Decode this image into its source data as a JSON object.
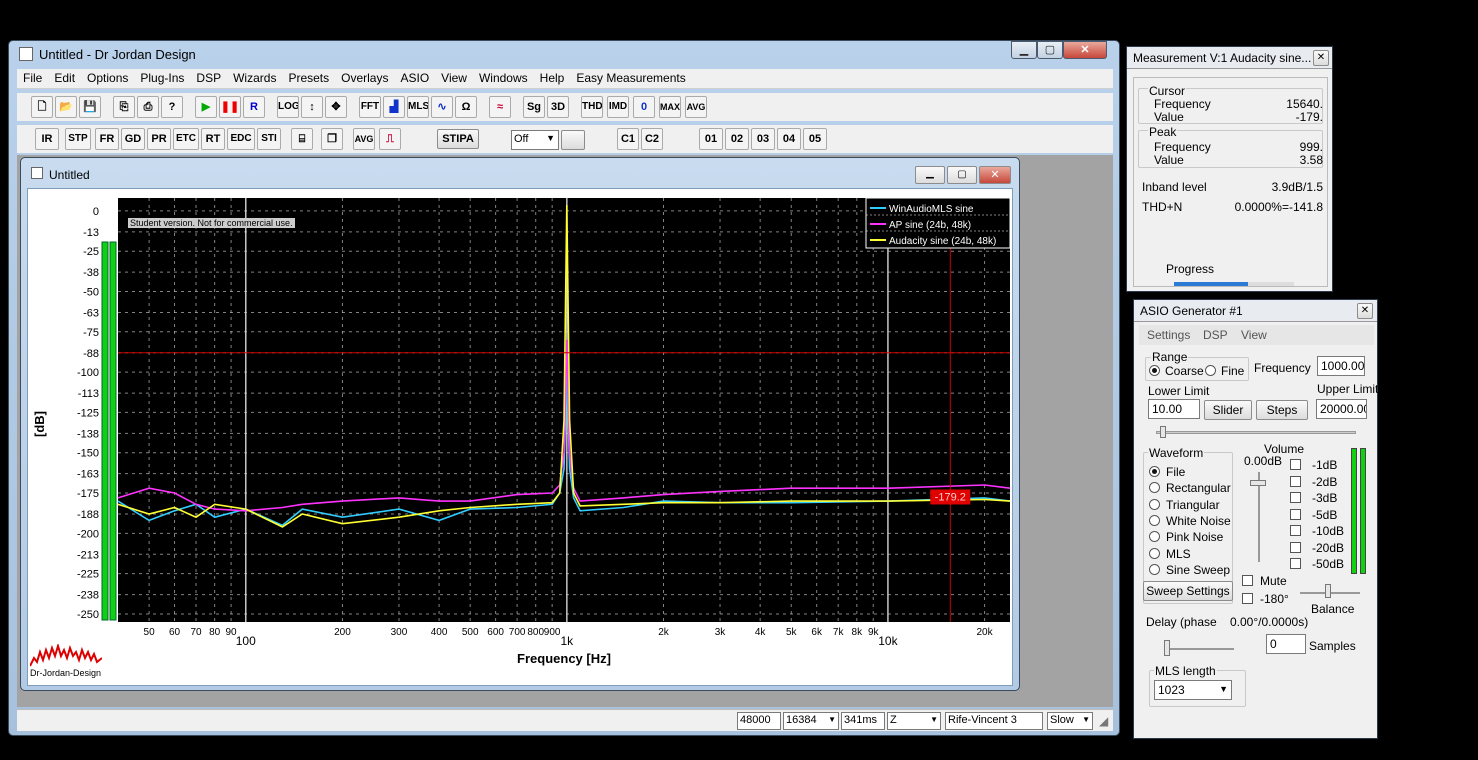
{
  "main": {
    "title": "Untitled - Dr Jordan Design",
    "menu": [
      "File",
      "Edit",
      "Options",
      "Plug-Ins",
      "DSP",
      "Wizards",
      "Presets",
      "Overlays",
      "ASIO",
      "View",
      "Windows",
      "Help",
      "Easy Measurements"
    ],
    "toolbar1": [
      "LOG",
      "FFT",
      "MLS",
      "Sg",
      "3D",
      "THD",
      "IMD",
      "0",
      "MAX",
      "AVG"
    ],
    "toolbar2": [
      "IR",
      "STP",
      "FR",
      "GD",
      "PR",
      "ETC",
      "RT",
      "EDC",
      "STI",
      "AVG",
      "STIPA",
      "C1",
      "C2",
      "01",
      "02",
      "03",
      "04",
      "05"
    ],
    "toolbar2_select": "Off",
    "status": {
      "rate": "48000",
      "fft": "16384",
      "time": "341ms",
      "mode": "Z",
      "window": "Rife-Vincent 3",
      "speed": "Slow"
    }
  },
  "child": {
    "title": "Untitled",
    "watermark": "Student version. Not for commercial use.",
    "logo_text": "Dr-Jordan-Design",
    "marker_label": "-179.2"
  },
  "chart_data": {
    "type": "line",
    "xlabel": "Frequency [Hz]",
    "ylabel": "[dB]",
    "xscale": "log",
    "xlim": [
      40,
      24000
    ],
    "ylim": [
      -255,
      8
    ],
    "yticks": [
      0,
      -13,
      -25,
      -38,
      -50,
      -63,
      -75,
      -88,
      -100,
      -113,
      -125,
      -138,
      -150,
      -163,
      -175,
      -188,
      -200,
      -213,
      -225,
      -238,
      -250
    ],
    "ytick_labels": [
      "0",
      "-13",
      "-25",
      "-38",
      "-50",
      "-63",
      "-75",
      "-88",
      "-100",
      "-113",
      "-125",
      "-138",
      "-150",
      "-163",
      "-175",
      "-188",
      "-200",
      "-213",
      "-225",
      "-238",
      "-250"
    ],
    "xticks": [
      50,
      60,
      70,
      80,
      90,
      100,
      200,
      300,
      400,
      500,
      600,
      700,
      800,
      900,
      1000,
      2000,
      3000,
      4000,
      5000,
      6000,
      7000,
      8000,
      9000,
      10000,
      20000
    ],
    "xtick_labels": [
      "50",
      "60",
      "70",
      "80",
      "90",
      "100",
      "200",
      "300",
      "400",
      "500",
      "600",
      "700",
      "800",
      "900",
      "1k",
      "2k",
      "3k",
      "4k",
      "5k",
      "6k",
      "7k",
      "8k",
      "9k",
      "10k",
      "20k"
    ],
    "cursor": {
      "x": 15640,
      "y": -88
    },
    "legend_position": "top-right",
    "series": [
      {
        "name": "WinAudioMLS sine",
        "color": "#33ccff",
        "x": [
          40,
          50,
          60,
          70,
          80,
          100,
          130,
          150,
          200,
          300,
          400,
          500,
          700,
          900,
          950,
          980,
          1000,
          1020,
          1050,
          1100,
          1500,
          2000,
          3000,
          5000,
          10000,
          20000,
          24000
        ],
        "y": [
          -180,
          -192,
          -186,
          -182,
          -190,
          -185,
          -195,
          -185,
          -190,
          -185,
          -192,
          -185,
          -184,
          -182,
          -175,
          -160,
          -100,
          -160,
          -178,
          -186,
          -184,
          -180,
          -181,
          -181,
          -180,
          -178,
          -180
        ]
      },
      {
        "name": "AP sine (24b, 48k)",
        "color": "#ff33ff",
        "x": [
          40,
          50,
          60,
          70,
          80,
          100,
          130,
          150,
          200,
          300,
          400,
          500,
          700,
          900,
          950,
          980,
          1000,
          1020,
          1050,
          1100,
          1500,
          2000,
          3000,
          5000,
          10000,
          20000,
          24000
        ],
        "y": [
          -178,
          -172,
          -175,
          -182,
          -185,
          -186,
          -184,
          -182,
          -180,
          -178,
          -180,
          -180,
          -176,
          -175,
          -170,
          -150,
          -80,
          -150,
          -172,
          -180,
          -178,
          -176,
          -174,
          -172,
          -172,
          -170,
          -172
        ]
      },
      {
        "name": "Audacity sine (24b, 48k)",
        "color": "#ffff33",
        "x": [
          40,
          50,
          60,
          70,
          80,
          100,
          130,
          150,
          200,
          300,
          400,
          500,
          700,
          900,
          950,
          980,
          1000,
          1020,
          1050,
          1100,
          1500,
          2000,
          3000,
          5000,
          10000,
          20000,
          24000
        ],
        "y": [
          -182,
          -188,
          -184,
          -190,
          -182,
          -185,
          -196,
          -188,
          -194,
          -190,
          -186,
          -184,
          -182,
          -181,
          -175,
          -130,
          3.58,
          -130,
          -175,
          -183,
          -182,
          -181,
          -181,
          -180,
          -180,
          -179,
          -180
        ]
      }
    ]
  },
  "measure": {
    "title": "Measurement V:1 Audacity sine...",
    "cursor_label": "Cursor",
    "cursor_freq_label": "Frequency",
    "cursor_freq": "15640.",
    "cursor_value_label": "Value",
    "cursor_value": "-179.",
    "peak_label": "Peak",
    "peak_freq_label": "Frequency",
    "peak_freq": "999.",
    "peak_value_label": "Value",
    "peak_value": "3.58",
    "inband_label": "Inband level",
    "inband": "3.9dB/1.5",
    "thd_label": "THD+N",
    "thd": "0.0000%=-141.8",
    "progress_label": "Progress",
    "progress": 0.62
  },
  "gen": {
    "title": "ASIO Generator #1",
    "menu": [
      "Settings",
      "DSP",
      "View"
    ],
    "range_label": "Range",
    "coarse": "Coarse",
    "fine": "Fine",
    "frequency_label": "Frequency",
    "frequency": "1000.00",
    "lower_label": "Lower Limit",
    "lower": "10.00",
    "upper_label": "Upper Limit",
    "upper": "20000.00",
    "slider_btn": "Slider",
    "steps_btn": "Steps",
    "waveform_label": "Waveform",
    "waveforms": [
      "File",
      "Rectangular",
      "Triangular",
      "White Noise",
      "Pink Noise",
      "MLS",
      "Sine Sweep"
    ],
    "volume_label": "Volume",
    "volume_value": "0.00dB",
    "attenuations": [
      "-1dB",
      "-2dB",
      "-3dB",
      "-5dB",
      "-10dB",
      "-20dB",
      "-50dB"
    ],
    "mute": "Mute",
    "phase180": "-180°",
    "balance": "Balance",
    "sweep_btn": "Sweep Settings",
    "delay_label": "Delay (phase",
    "delay_value": "0.00°/0.0000s)",
    "samples_value": "0",
    "samples_label": "Samples",
    "mls_label": "MLS length",
    "mls_value": "1023"
  }
}
